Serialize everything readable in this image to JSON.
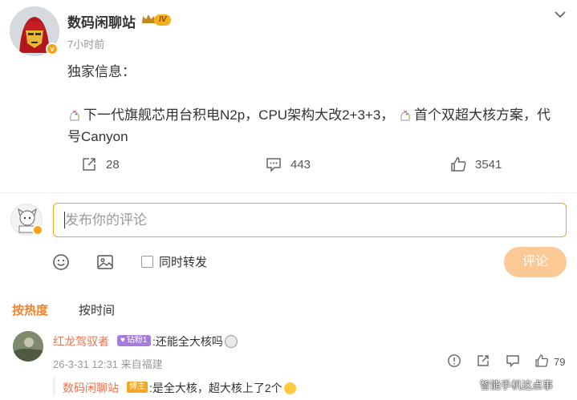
{
  "post": {
    "author": "数码闲聊站",
    "level": "IV",
    "time": "7小时前",
    "content_line1": "独家信息：",
    "content_line2": "下一代旗舰芯用台积电N2p，CPU架构大改2+3+3，",
    "content_line2b": "首个双超大核方案，代",
    "content_line3": "号Canyon",
    "reposts": "28",
    "comments": "443",
    "likes": "3541"
  },
  "composer": {
    "placeholder": "发布你的评论",
    "repost_label": "同时转发",
    "submit_label": "评论"
  },
  "tabs": [
    {
      "label": "按热度"
    },
    {
      "label": "按时间"
    }
  ],
  "comment": {
    "user": "红龙驾驭者",
    "fan_badge": "钻粉1",
    "text": ":还能全大核吗",
    "meta": "26-3-31 12:31 来自福建",
    "likes": "79"
  },
  "reply": {
    "user": "数码闲聊站",
    "badge": "博主",
    "text": ":是全大核，超大核上了2个"
  },
  "watermark": "智能手机这点事",
  "colors": {
    "accent": "#f7a317",
    "username": "#eb7350",
    "submit_disabled": "#fcc895"
  }
}
